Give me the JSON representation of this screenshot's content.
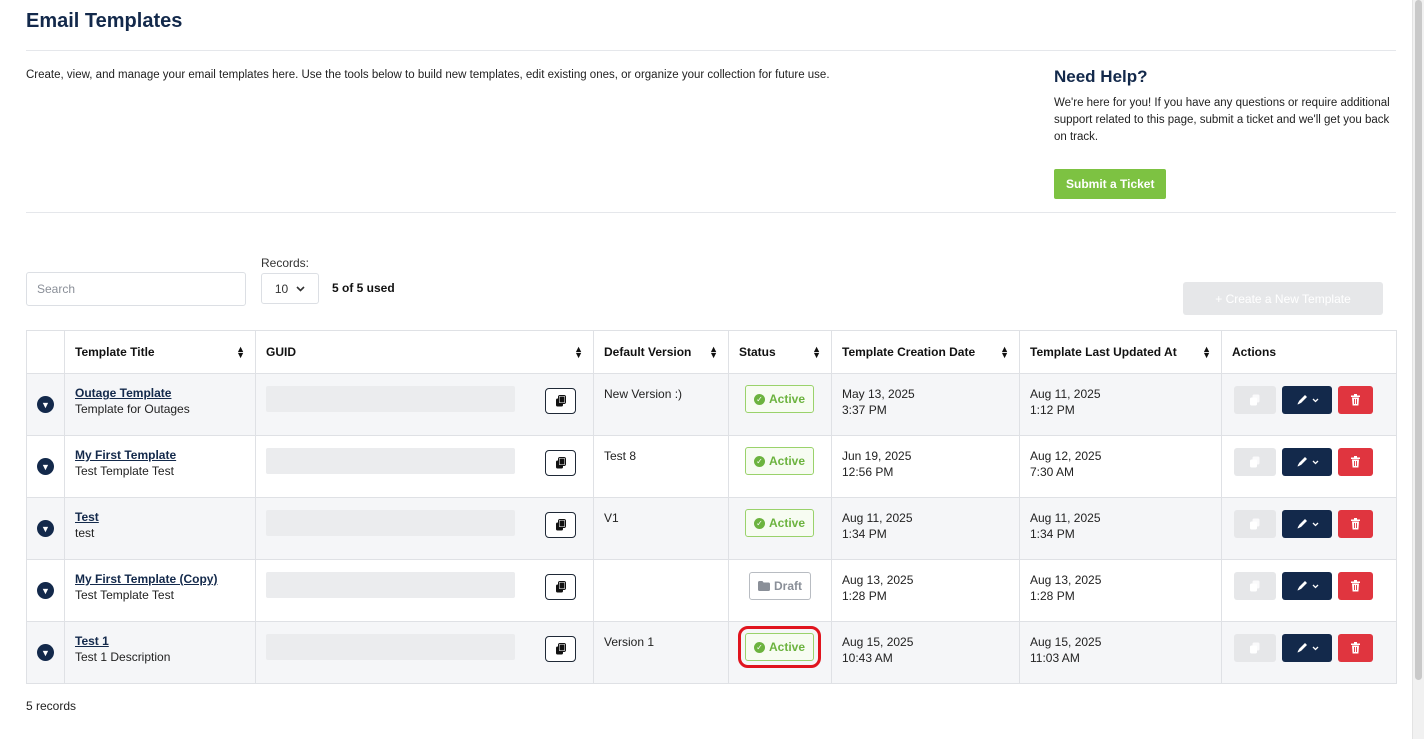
{
  "page": {
    "title": "Email Templates",
    "intro": "Create, view, and manage your email templates here. Use the tools below to build new templates, edit existing ones, or organize your collection for future use."
  },
  "help": {
    "title": "Need Help?",
    "text": "We're here for you! If you have any questions or require additional support related to this page, submit a ticket and we'll get you back on track.",
    "button": "Submit a Ticket"
  },
  "toolbar": {
    "search_placeholder": "Search",
    "records_label": "Records:",
    "records_value": "10",
    "records_used": "5 of 5 used",
    "create_label": "+ Create a New Template"
  },
  "table": {
    "headers": {
      "title": "Template Title",
      "guid": "GUID",
      "version": "Default Version",
      "status": "Status",
      "created": "Template Creation Date",
      "updated": "Template Last Updated At",
      "actions": "Actions"
    },
    "rows": [
      {
        "title": "Outage Template",
        "description": "Template for Outages",
        "version": "New Version :)",
        "status": "Active",
        "created_date": "May 13, 2025",
        "created_time": "3:37 PM",
        "updated_date": "Aug 11, 2025",
        "updated_time": "1:12 PM"
      },
      {
        "title": "My First Template",
        "description": "Test Template Test",
        "version": "Test 8",
        "status": "Active",
        "created_date": "Jun 19, 2025",
        "created_time": "12:56 PM",
        "updated_date": "Aug 12, 2025",
        "updated_time": "7:30 AM"
      },
      {
        "title": "Test",
        "description": "test",
        "version": "V1",
        "status": "Active",
        "created_date": "Aug 11, 2025",
        "created_time": "1:34 PM",
        "updated_date": "Aug 11, 2025",
        "updated_time": "1:34 PM"
      },
      {
        "title": "My First Template (Copy)",
        "description": "Test Template Test",
        "version": "",
        "status": "Draft",
        "created_date": "Aug 13, 2025",
        "created_time": "1:28 PM",
        "updated_date": "Aug 13, 2025",
        "updated_time": "1:28 PM"
      },
      {
        "title": "Test 1",
        "description": "Test 1 Description",
        "version": "Version 1",
        "status": "Active",
        "created_date": "Aug 15, 2025",
        "created_time": "10:43 AM",
        "updated_date": "Aug 15, 2025",
        "updated_time": "11:03 AM"
      }
    ],
    "highlight_color": "#e0141e"
  },
  "footer": {
    "count": "5 records"
  },
  "colors": {
    "brand_navy": "#13294b",
    "accent_green": "#7dc242",
    "active_green": "#6cb33f",
    "danger_red": "#e0353f"
  },
  "icons": {
    "copy": "copy-icon",
    "edit": "pencil-icon",
    "delete": "trash-icon",
    "expand": "chevron-down-icon",
    "active": "check-circle-icon",
    "draft": "folder-icon"
  }
}
